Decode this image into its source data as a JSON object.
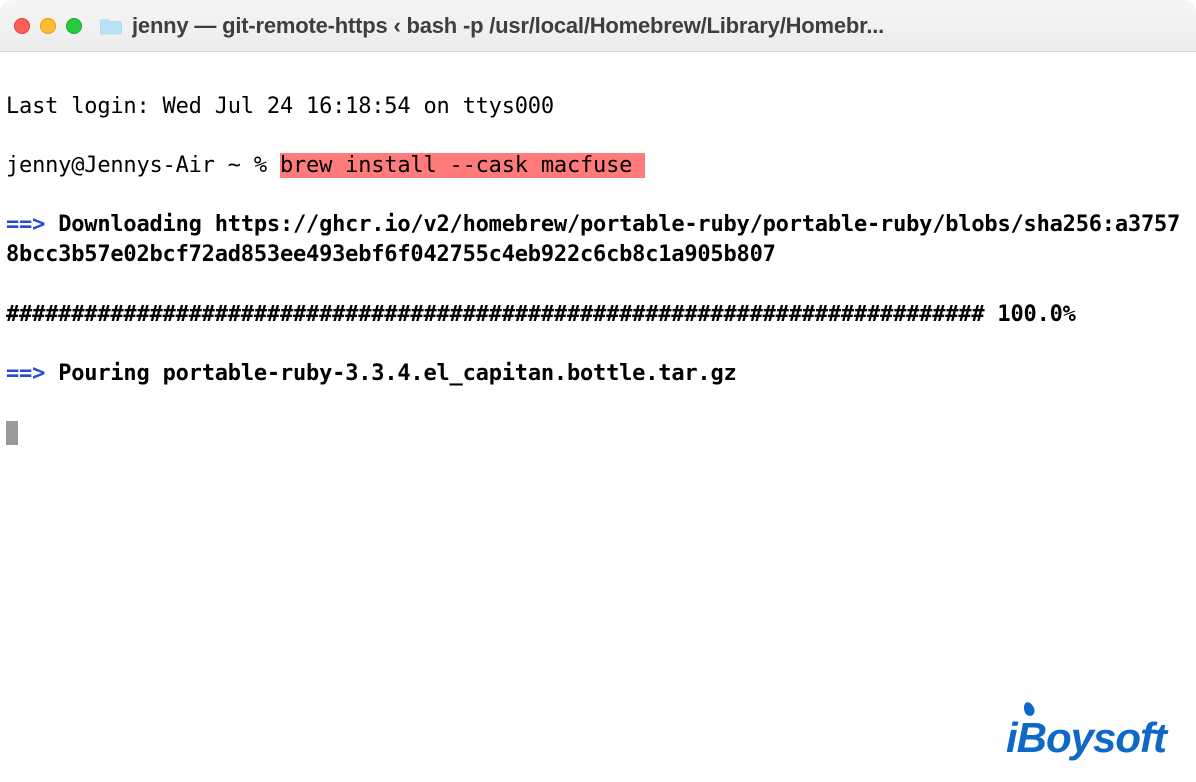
{
  "window": {
    "title": "jenny — git-remote-https ‹ bash -p /usr/local/Homebrew/Library/Homebr..."
  },
  "terminal": {
    "last_login": "Last login: Wed Jul 24 16:18:54 on ttys000",
    "prompt_prefix": "jenny@Jennys-Air ~ % ",
    "command": "brew install --cask macfuse ",
    "arrow": "==> ",
    "downloading_label": "Downloading ",
    "download_url": "https://ghcr.io/v2/homebrew/portable-ruby/portable-ruby/blobs/sha256:a37578bcc3b57e02bcf72ad853ee493ebf6f042755c4eb922c6cb8c1a905b807",
    "progress_hashes": "###########################################################################",
    "progress_pct": " 100.0%",
    "pouring_label": "Pouring ",
    "pouring_file": "portable-ruby-3.3.4.el_capitan.bottle.tar.gz"
  },
  "watermark": "iBoysoft"
}
